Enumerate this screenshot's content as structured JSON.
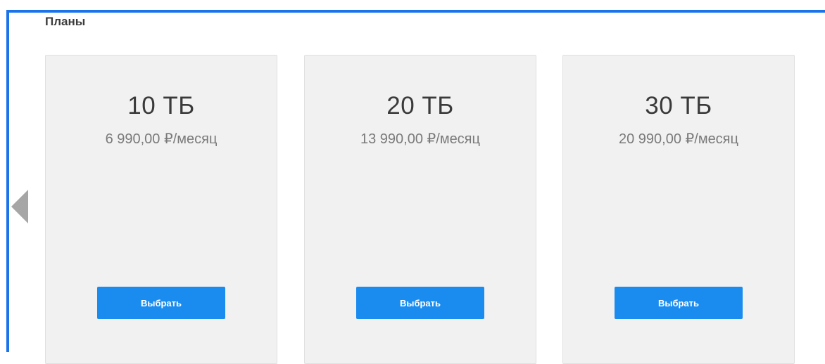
{
  "section": {
    "title": "Планы"
  },
  "navigation": {
    "prev_icon": "chevron-left-icon"
  },
  "plans": [
    {
      "size": "10 ТБ",
      "price": "6 990,00 ₽/месяц",
      "button_label": "Выбрать"
    },
    {
      "size": "20 ТБ",
      "price": "13 990,00 ₽/месяц",
      "button_label": "Выбрать"
    },
    {
      "size": "30 ТБ",
      "price": "20 990,00 ₽/месяц",
      "button_label": "Выбрать"
    }
  ],
  "colors": {
    "frame_border": "#1a73e8",
    "button": "#1a8cf0",
    "card_background": "#f1f1f1",
    "arrow": "#a6a6a6"
  }
}
